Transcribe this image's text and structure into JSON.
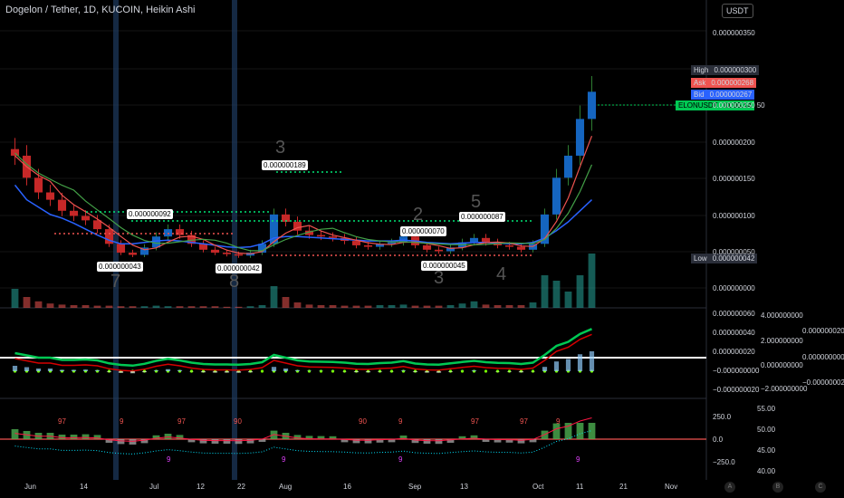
{
  "header": {
    "title": "Dogelon / Tether, 1D, KUCOIN, Heikin Ashi",
    "currency": "USDT"
  },
  "price_labels": {
    "high": {
      "tag": "High",
      "value": "0.000000300",
      "color": "#2a2e39"
    },
    "ask": {
      "tag": "Ask",
      "value": "0.000000268",
      "color": "#ef5350"
    },
    "bid": {
      "tag": "Bid",
      "value": "0.000000267",
      "color": "#2962ff"
    },
    "last": {
      "tag": "ELONUSDT",
      "value": "01:05:14",
      "suffix": "50",
      "color": "#00c853"
    },
    "low": {
      "tag": "Low",
      "value": "0.000000042",
      "color": "#2a2e39"
    }
  },
  "axes": {
    "main_ticks": [
      "0.000000350",
      "0.000000250",
      "0.000000200",
      "0.000000150",
      "0.000000100",
      "0.000000050",
      "0.000000000"
    ],
    "osc_ticks_a": [
      "0.000000060",
      "0.000000040",
      "0.000000020",
      "−0.000000000",
      "−0.000000020"
    ],
    "osc_ticks_b": [
      "4.000000000",
      "2.000000000",
      "0.000000000",
      "−2.000000000"
    ],
    "osc_ticks_c": [
      "0.000000020",
      "0.000000000",
      "−0.000000020"
    ],
    "rsi_ticks_left": [
      "250.0",
      "0.0",
      "−250.0"
    ],
    "rsi_ticks_right": [
      "55.00",
      "50.00",
      "45.00",
      "40.00"
    ],
    "x_ticks": [
      "Jun",
      "14",
      "Jul",
      "12",
      "22",
      "Aug",
      "16",
      "Sep",
      "13",
      "Oct",
      "11",
      "21",
      "Nov"
    ]
  },
  "annotations": {
    "price_marks": [
      "0.000000092",
      "0.000000043",
      "0.000000042",
      "0.000000189",
      "0.000000070",
      "0.000000045",
      "0.000000087"
    ],
    "waves": [
      "7",
      "8",
      "3",
      "2",
      "3",
      "5",
      "4"
    ],
    "counts": [
      "97",
      "9",
      "97",
      "90",
      "90",
      "9",
      "97",
      "97",
      "9"
    ],
    "bottom_nums": [
      "9",
      "9",
      "9",
      "9"
    ]
  },
  "footer_icons": [
    "A",
    "B",
    "C"
  ],
  "chart_data": {
    "type": "candlestick",
    "title": "Dogelon / Tether, 1D, KUCOIN, Heikin Ashi",
    "ylim": [
      0,
      3.5e-07
    ],
    "x": [
      "Jun",
      "14",
      "Jul",
      "12",
      "22",
      "Aug",
      "16",
      "Sep",
      "13",
      "Oct",
      "11",
      "21",
      "Nov"
    ],
    "close": [
      1.8e-07,
      1.5e-07,
      1.3e-07,
      1.2e-07,
      1.05e-07,
      9.8e-08,
      9.2e-08,
      8e-08,
      6e-08,
      4.8e-08,
      4.5e-08,
      5.5e-08,
      7e-08,
      8e-08,
      7.2e-08,
      6e-08,
      5.2e-08,
      4.8e-08,
      4.6e-08,
      4.4e-08,
      4.8e-08,
      6e-08,
      1e-07,
      9e-08,
      7.8e-08,
      7.2e-08,
      7e-08,
      6.8e-08,
      6.4e-08,
      5.8e-08,
      5.6e-08,
      6e-08,
      6.2e-08,
      7e-08,
      5.8e-08,
      5.2e-08,
      5e-08,
      5.5e-08,
      6.2e-08,
      6.8e-08,
      6.2e-08,
      5.8e-08,
      5.6e-08,
      5.2e-08,
      6e-08,
      1e-07,
      1.5e-07,
      1.8e-07,
      2.3e-07,
      2.67e-07
    ],
    "ma_slow": [
      1.4e-07,
      1.2e-07,
      1.1e-07,
      1e-07,
      9.5e-08,
      8.8e-08,
      8e-08,
      7.2e-08,
      6.5e-08,
      6e-08,
      6e-08,
      6.2e-08,
      6.4e-08,
      6.5e-08,
      6.4e-08,
      6.2e-08,
      6e-08,
      5.8e-08,
      5.6e-08,
      5.5e-08,
      5.6e-08,
      6e-08,
      6.8e-08,
      7e-08,
      7e-08,
      6.9e-08,
      6.8e-08,
      6.7e-08,
      6.6e-08,
      6.5e-08,
      6.4e-08,
      6.4e-08,
      6.4e-08,
      6.5e-08,
      6.4e-08,
      6.2e-08,
      6.1e-08,
      6e-08,
      6.1e-08,
      6.2e-08,
      6.2e-08,
      6.1e-08,
      6e-08,
      6e-08,
      6.2e-08,
      6.8e-08,
      7.8e-08,
      9e-08,
      1.05e-07,
      1.2e-07
    ],
    "volume": [
      0.35,
      0.2,
      0.12,
      0.08,
      0.06,
      0.05,
      0.05,
      0.04,
      0.04,
      0.03,
      0.03,
      0.03,
      0.04,
      0.03,
      0.03,
      0.03,
      0.03,
      0.03,
      0.02,
      0.02,
      0.03,
      0.05,
      0.4,
      0.2,
      0.1,
      0.06,
      0.05,
      0.05,
      0.04,
      0.04,
      0.04,
      0.05,
      0.05,
      0.06,
      0.04,
      0.04,
      0.04,
      0.05,
      0.08,
      0.12,
      0.06,
      0.05,
      0.05,
      0.05,
      0.1,
      0.6,
      0.5,
      0.3,
      0.6,
      1.0
    ]
  }
}
